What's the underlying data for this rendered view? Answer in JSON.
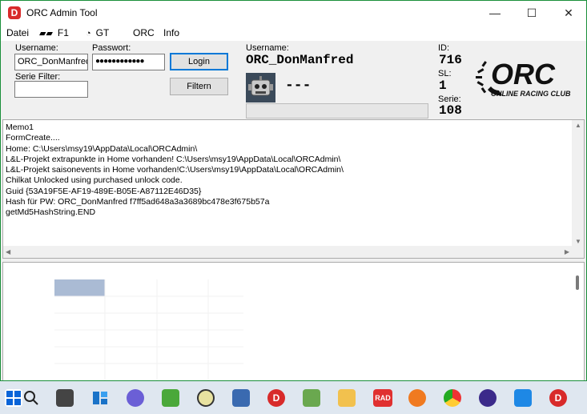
{
  "window": {
    "title": "ORC Admin Tool",
    "app_icon_letter": "D"
  },
  "titlebar_buttons": {
    "minimize": "—",
    "maximize": "☐",
    "close": "✕"
  },
  "menu": [
    {
      "label": "Datei"
    },
    {
      "icon": "f1-logo-icon",
      "label": "F1"
    },
    {
      "icon": "gt-logo-icon",
      "label": "GT"
    },
    {
      "label": "ORC"
    },
    {
      "label": "Info"
    }
  ],
  "login": {
    "username_label": "Username:",
    "username_value": "ORC_DonManfred",
    "password_label": "Passwort:",
    "password_value": "●●●●●●●●●●●●",
    "serie_filter_label": "Serie Filter:",
    "serie_filter_value": "",
    "login_button": "Login",
    "filter_button": "Filtern"
  },
  "profile": {
    "username_label": "Username:",
    "username_value": "ORC_DonManfred",
    "status_value": "---",
    "id_label": "ID:",
    "id_value": "716",
    "sl_label": "SL:",
    "sl_value": "1",
    "serie_label": "Serie:",
    "serie_value": "108"
  },
  "logo": {
    "text": "ORC",
    "subtitle": "ONLINE RACING CLUB"
  },
  "memo": {
    "lines": "Memo1\nFormCreate....\nHome: C:\\Users\\msy19\\AppData\\Local\\ORCAdmin\\\nL&L-Projekt extrapunkte in Home vorhanden! C:\\Users\\msy19\\AppData\\Local\\ORCAdmin\\\nL&L-Projekt saisonevents in Home vorhanden!C:\\Users\\msy19\\AppData\\Local\\ORCAdmin\\\nChilkat Unlocked using purchased unlock code.\nGuid {53A19F5E-AF19-489E-B05E-A87112E46D35}\nHash für PW: ORC_DonManfred f7ff5ad648a3a3689bc478e3f675b57a\ngetMd5HashString.END"
  },
  "taskbar": {
    "icons": [
      "windows-start-icon",
      "search-icon",
      "task-view-icon",
      "widgets-icon",
      "chat-icon",
      "torrent-icon",
      "clock-app-icon",
      "network-admin-icon",
      "orc-admin-icon",
      "notepad-icon",
      "file-explorer-icon",
      "rad-icon",
      "firefox-icon",
      "chrome-icon",
      "dark-circle-app-icon",
      "vscode-icon",
      "orc-app-icon"
    ],
    "rad_label": "RAD"
  },
  "colors": {
    "accent": "#0078d7",
    "window_border": "#1a8f3a",
    "orc_red": "#d82a2a",
    "grid_selection": "#aabbd4"
  }
}
